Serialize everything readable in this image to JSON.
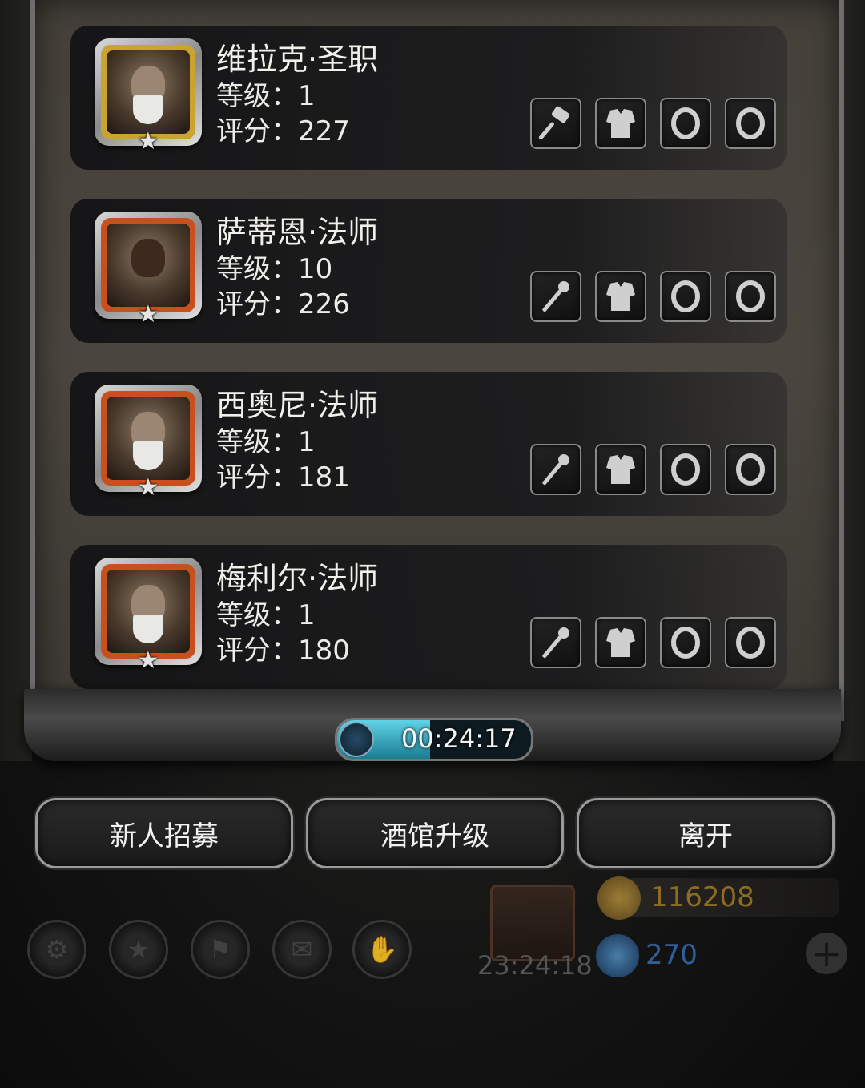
{
  "heroes": [
    {
      "name": "维拉克·圣职",
      "level": "等级：1",
      "score": "评分：227",
      "frame_color": "#c9a431",
      "face": "old",
      "slots": [
        "hammer-icon",
        "armor-icon",
        "ring-icon",
        "ring-icon"
      ]
    },
    {
      "name": "萨蒂恩·法师",
      "level": "等级：10",
      "score": "评分：226",
      "frame_color": "#c8501f",
      "face": "dark",
      "slots": [
        "staff-icon",
        "armor-icon",
        "ring-icon",
        "ring-icon"
      ]
    },
    {
      "name": "西奥尼·法师",
      "level": "等级：1",
      "score": "评分：181",
      "frame_color": "#c8501f",
      "face": "old",
      "slots": [
        "staff-icon",
        "armor-icon",
        "ring-icon",
        "ring-icon"
      ]
    },
    {
      "name": "梅利尔·法师",
      "level": "等级：1",
      "score": "评分：180",
      "frame_color": "#c8501f",
      "face": "old",
      "slots": [
        "staff-icon",
        "armor-icon",
        "ring-icon",
        "ring-icon"
      ]
    }
  ],
  "timer": {
    "text": "00:24:17",
    "progress": 0.48
  },
  "buttons": {
    "recruit": "新人招募",
    "upgrade": "酒馆升级",
    "leave": "离开"
  },
  "bottom_icons": [
    "gear-icon",
    "star-badge-icon",
    "banner-icon",
    "mail-icon",
    "handshake-icon"
  ],
  "gift": {
    "time": "23:24:18"
  },
  "resources": {
    "gold": "116208",
    "gems": "270"
  },
  "colors": {
    "panel": "#46423b",
    "card": "#161618",
    "timer_fill": "#3fb6cf"
  }
}
